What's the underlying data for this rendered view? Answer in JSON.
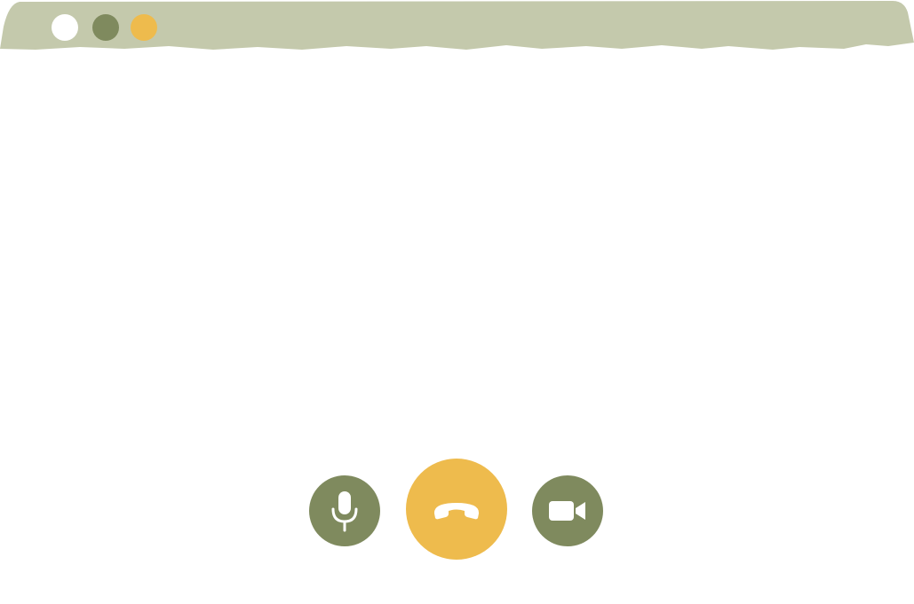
{
  "window": {
    "background": "#ffffff",
    "titlebar_color": "#c4c9ac",
    "traffic_lights": [
      {
        "name": "close",
        "color": "#ffffff"
      },
      {
        "name": "minimize",
        "color": "#7f8a5e"
      },
      {
        "name": "maximize",
        "color": "#eebb4d"
      }
    ]
  },
  "call_controls": [
    {
      "name": "mute",
      "icon": "microphone-icon",
      "color": "#7f8a5e"
    },
    {
      "name": "hang-up",
      "icon": "phone-hangup-icon",
      "color": "#eebb4d"
    },
    {
      "name": "camera",
      "icon": "video-camera-icon",
      "color": "#7f8a5e"
    }
  ]
}
